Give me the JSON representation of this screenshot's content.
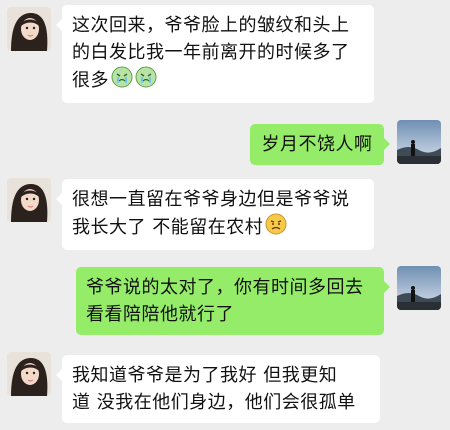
{
  "messages": [
    {
      "sender": "other",
      "lines": [
        "这次回来，爷爷脸上的皱纹和头上",
        "的白发比我一年前离开的时候多了",
        "很多"
      ],
      "emoji": [
        "green-crying-face-icon",
        "green-crying-face-icon"
      ]
    },
    {
      "sender": "self",
      "lines": [
        "岁月不饶人啊"
      ]
    },
    {
      "sender": "other",
      "lines": [
        "很想一直留在爷爷身边但是爷爷说",
        "我长大了 不能留在农村"
      ],
      "emoji": [
        "sad-face-icon"
      ]
    },
    {
      "sender": "self",
      "lines": [
        "爷爷说的太对了，你有时间多回去",
        "看看陪陪他就行了"
      ]
    },
    {
      "sender": "other",
      "lines": [
        "我知道爷爷是为了我好  但我更知",
        "道  没我在他们身边，他们会很孤单"
      ]
    }
  ],
  "colors": {
    "background": "#ededed",
    "incoming_bubble": "#ffffff",
    "outgoing_bubble": "#95ec69"
  }
}
